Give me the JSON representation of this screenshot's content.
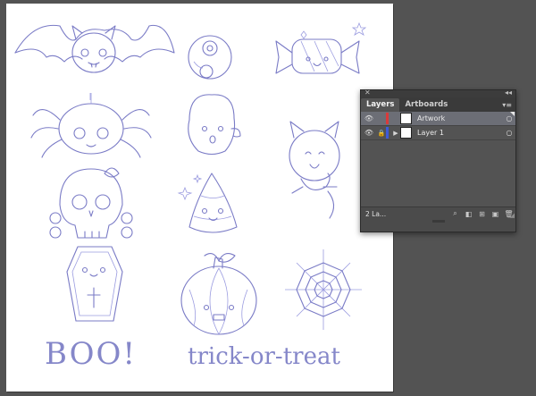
{
  "artboard": {
    "captions": {
      "boo": "BOO!",
      "trick": "trick-or-treat"
    },
    "sketch_color": "#7a7bc6",
    "background": "#ffffff"
  },
  "layers_panel": {
    "tabs": [
      "Layers",
      "Artboards"
    ],
    "layers": [
      {
        "name": "Artwork",
        "color": "#d93b3b",
        "selected": true,
        "locked": false,
        "expanded": false
      },
      {
        "name": "Layer 1",
        "color": "#3d5bd9",
        "selected": false,
        "locked": true,
        "expanded": false
      }
    ],
    "footer_count": "2 La...",
    "icons": {
      "close": "close-icon",
      "collapse": "double-arrow-icon",
      "menu": "panel-menu-icon",
      "visibility": "eye-icon",
      "lock": "lock-icon",
      "expand": "disclosure-triangle-icon",
      "target": "target-circle-icon"
    }
  },
  "colors": {
    "workspace": "#535353",
    "panel": "#4b4b4b",
    "selected_row": "#6c6e76"
  }
}
